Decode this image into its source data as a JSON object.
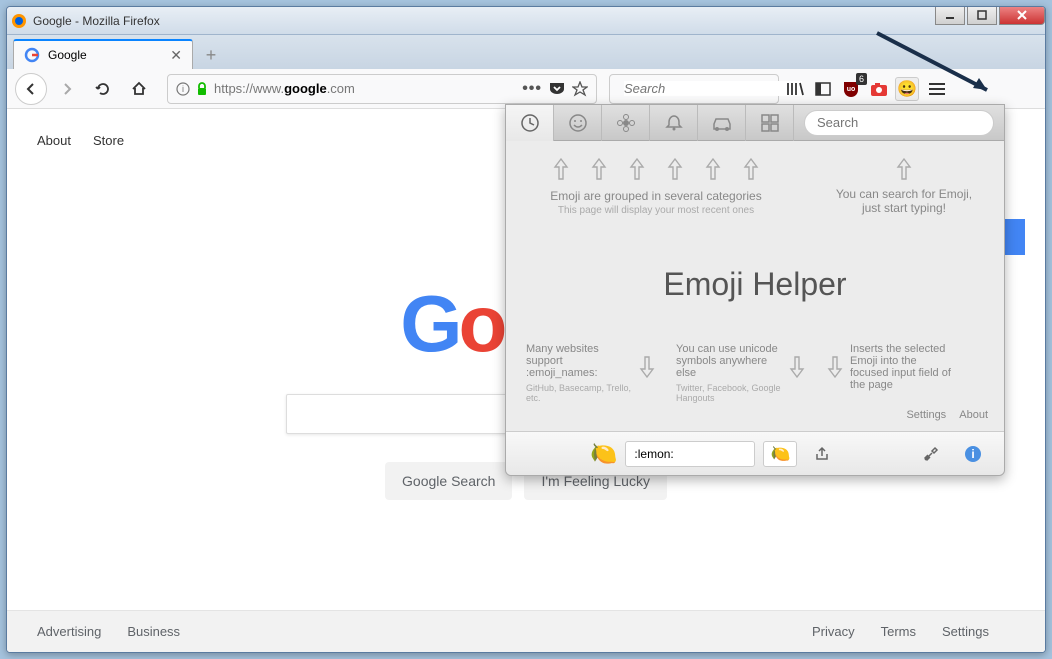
{
  "window": {
    "title": "Google - Mozilla Firefox"
  },
  "tabs": [
    {
      "title": "Google"
    }
  ],
  "urlbar": {
    "protocol": "https://www.",
    "domain": "google",
    "tld": ".com"
  },
  "searchbar": {
    "placeholder": "Search"
  },
  "extensions": {
    "ublock_badge": "6"
  },
  "google": {
    "nav": {
      "about": "About",
      "store": "Store"
    },
    "buttons": {
      "search": "Google Search",
      "lucky": "I'm Feeling Lucky"
    },
    "footer": {
      "advertising": "Advertising",
      "business": "Business",
      "privacy": "Privacy",
      "terms": "Terms",
      "settings": "Settings"
    }
  },
  "emoji": {
    "search_placeholder": "Search",
    "hint_categories": "Emoji are grouped in several categories",
    "hint_categories_sub": "This page will display your most recent ones",
    "hint_search": "You can search for Emoji, just start typing!",
    "title": "Emoji Helper",
    "hint_names": "Many websites support :emoji_names:",
    "hint_names_sub": "GitHub, Basecamp, Trello, etc.",
    "hint_unicode": "You can use unicode symbols anywhere else",
    "hint_unicode_sub": "Twitter, Facebook, Google Hangouts",
    "hint_insert": "Inserts the selected Emoji into the focused input field of the page",
    "link_settings": "Settings",
    "link_about": "About",
    "code": ":lemon:"
  }
}
